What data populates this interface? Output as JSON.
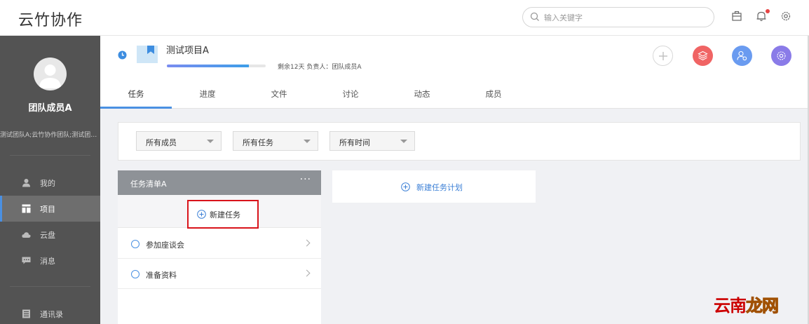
{
  "app": {
    "logo_text": "云竹协作"
  },
  "search": {
    "placeholder": "输入关键字",
    "icon": "search-icon"
  },
  "top_icons": [
    "briefcase-icon",
    "bell-icon",
    "gear-icon"
  ],
  "colors": {
    "sidebar_bg": "#535353",
    "accent": "#4a90e2",
    "btn_gray": "#e8e8e8",
    "btn_red": "#f06464",
    "btn_blue": "#6a9bf0",
    "btn_purple": "#8a7be8",
    "highlight_red": "#d9141b"
  },
  "sidebar": {
    "username": "团队成员A",
    "teams": "测试团队A;云竹协作团队;测试团队B",
    "nav": [
      {
        "label": "我的",
        "icon": "user-icon"
      },
      {
        "label": "项目",
        "icon": "project-icon",
        "active": true
      },
      {
        "label": "云盘",
        "icon": "cloud-icon"
      },
      {
        "label": "消息",
        "icon": "message-icon"
      },
      {
        "label": "通讯录",
        "icon": "contacts-icon"
      }
    ]
  },
  "project": {
    "name": "测试项目A",
    "progress": 0.83,
    "meta": "剩余12天 负责人：团队成员A",
    "actions": [
      "add-icon",
      "layers-icon",
      "member-icon",
      "settings-icon"
    ]
  },
  "tabs": [
    {
      "label": "任务",
      "active": true
    },
    {
      "label": "进度"
    },
    {
      "label": "文件"
    },
    {
      "label": "讨论"
    },
    {
      "label": "动态"
    },
    {
      "label": "成员"
    }
  ],
  "filters": [
    {
      "selected": "所有成员"
    },
    {
      "selected": "所有任务"
    },
    {
      "selected": "所有时间"
    }
  ],
  "tasklist": {
    "title": "任务清单A",
    "more": "···",
    "new_task_label": "新建任务",
    "tasks": [
      {
        "label": "参加座谈会"
      },
      {
        "label": "准备资料"
      }
    ]
  },
  "new_plan_label": "新建任务计划",
  "watermark": {
    "part1": "云南",
    "part2": "龙网"
  }
}
